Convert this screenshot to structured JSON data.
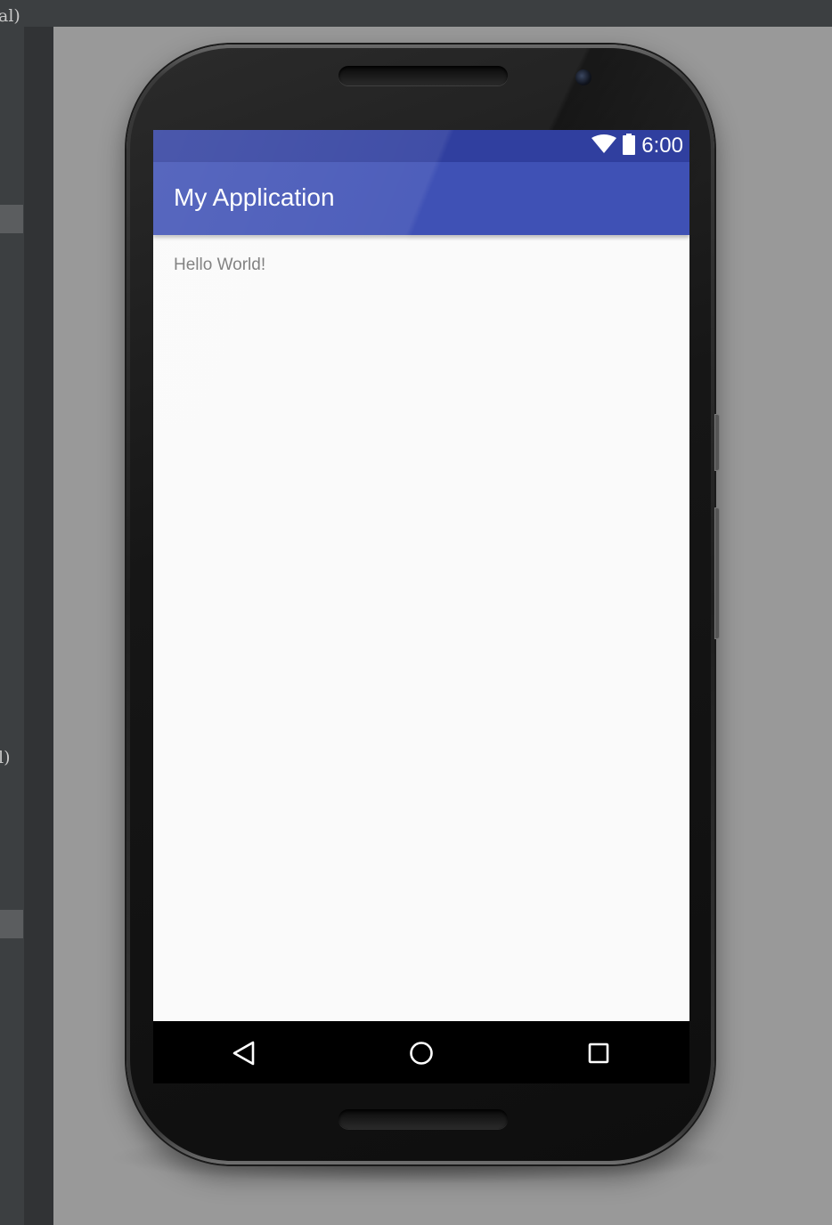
{
  "ide": {
    "clipped_text_top": "al)",
    "clipped_text_bottom": "l)"
  },
  "device": {
    "status_bar": {
      "time": "6:00",
      "icons": [
        "wifi-icon",
        "battery-icon"
      ],
      "color": "#303f9f"
    },
    "app_bar": {
      "title": "My Application",
      "color": "#3f51b5"
    },
    "content": {
      "text": "Hello World!",
      "background": "#fafafa"
    },
    "nav_bar": {
      "buttons": [
        "back-icon",
        "home-icon",
        "recents-icon"
      ]
    }
  }
}
